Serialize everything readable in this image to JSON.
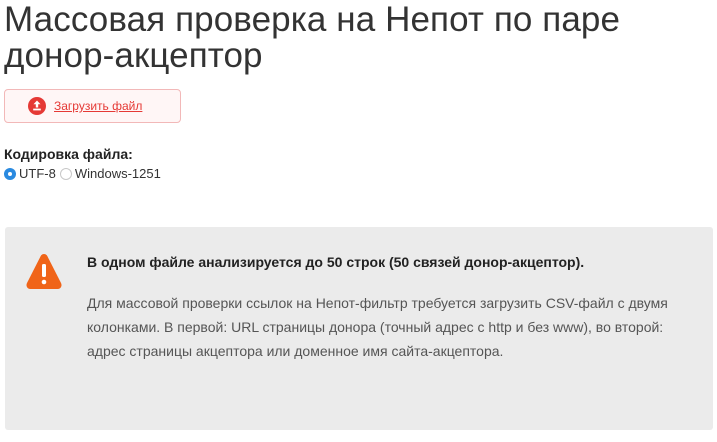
{
  "page": {
    "title": "Массовая проверка на Непот по паре донор-акцептор"
  },
  "upload": {
    "label": "Загрузить файл",
    "icon": "upload-icon",
    "color": "#e53935"
  },
  "encoding": {
    "title": "Кодировка файла:",
    "options": [
      {
        "label": "UTF-8",
        "selected": true
      },
      {
        "label": "Windows-1251",
        "selected": false
      }
    ]
  },
  "notice": {
    "icon": "warning-icon",
    "icon_color": "#f06418",
    "heading": "В одном файле анализируется до 50 строк (50 связей донор-акцептор).",
    "text": "Для массовой проверки ссылок на Непот-фильтр требуется загрузить CSV-файл с двумя колонками. В первой: URL страницы донора (точный адрес с http и без www), во второй: адрес страницы акцептора или доменное имя сайта-акцептора."
  }
}
